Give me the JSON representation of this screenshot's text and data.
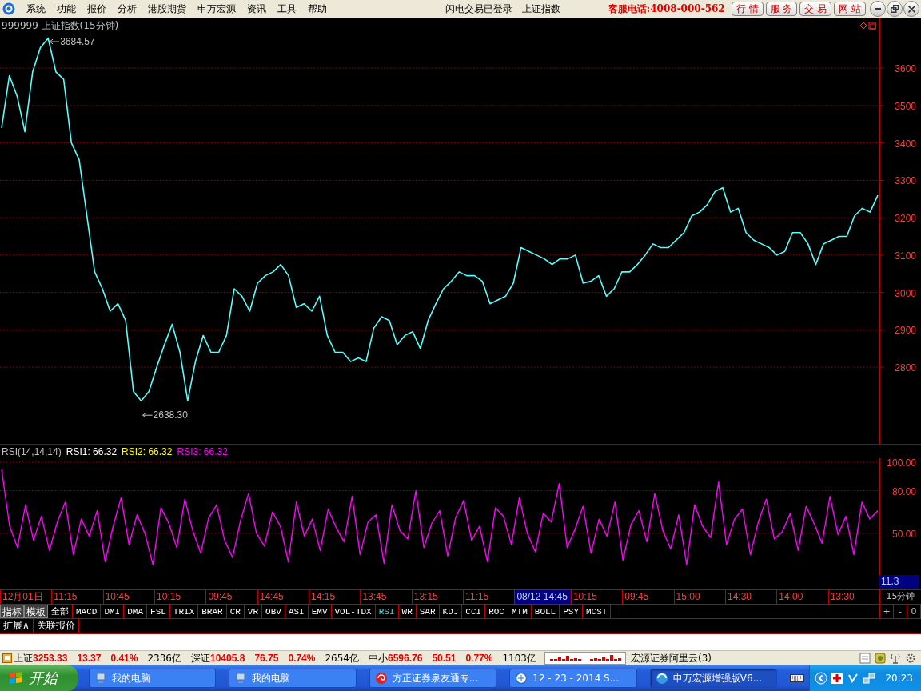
{
  "menu_bar": {
    "items": [
      "系统",
      "功能",
      "报价",
      "分析",
      "港股期货",
      "申万宏源",
      "资讯",
      "工具",
      "帮助"
    ],
    "status_texts": [
      "闪电交易已登录",
      "上证指数"
    ],
    "hotline": "客服电话:4008-000-562",
    "quick_buttons": [
      "行 情",
      "服 务",
      "交 易",
      "网 站"
    ]
  },
  "price_chart": {
    "title": "999999 上证指数(15分钟)",
    "chart_data": {
      "type": "line",
      "grid": true,
      "ylim": [
        2595,
        3735
      ],
      "yticks": [
        2800,
        2900,
        3000,
        3100,
        3200,
        3300,
        3400,
        3500,
        3600
      ],
      "series": [
        {
          "color": "#54ffff",
          "values": [
            3440,
            3580,
            3525,
            3430,
            3590,
            3655,
            3680,
            3590,
            3570,
            3400,
            3355,
            3205,
            3055,
            3010,
            2950,
            2970,
            2925,
            2735,
            2710,
            2735,
            2800,
            2860,
            2915,
            2840,
            2710,
            2815,
            2885,
            2840,
            2840,
            2885,
            3010,
            2990,
            2950,
            3025,
            3045,
            3055,
            3075,
            3045,
            2960,
            2970,
            2950,
            2990,
            2885,
            2840,
            2840,
            2815,
            2825,
            2815,
            2905,
            2935,
            2925,
            2860,
            2885,
            2895,
            2850,
            2925,
            2970,
            3010,
            3030,
            3055,
            3045,
            3045,
            3030,
            2970,
            2980,
            2990,
            3025,
            3120,
            3110,
            3100,
            3090,
            3075,
            3090,
            3090,
            3100,
            3025,
            3030,
            3045,
            2990,
            3010,
            3055,
            3055,
            3075,
            3100,
            3130,
            3120,
            3120,
            3140,
            3160,
            3205,
            3215,
            3235,
            3270,
            3280,
            3215,
            3225,
            3160,
            3140,
            3130,
            3120,
            3100,
            3110,
            3160,
            3160,
            3130,
            3075,
            3130,
            3140,
            3150,
            3150,
            3205,
            3225,
            3215,
            3260
          ]
        }
      ]
    },
    "high_label": "3684.57",
    "low_label": "2638.30"
  },
  "rsi_panel": {
    "legend": [
      {
        "text": "RSI(14,14,14)",
        "color": "#c0c0c0"
      },
      {
        "text": "RSI1: 66.32",
        "color": "#ffffff"
      },
      {
        "text": "RSI2: 66.32",
        "color": "#ffff00"
      },
      {
        "text": "RSI3: 66.32",
        "color": "#ff00ff"
      }
    ],
    "chart_data": {
      "type": "line",
      "grid": true,
      "ylim": [
        10.6,
        102.8
      ],
      "yticks": [
        {
          "value": 50,
          "label": "50.00"
        },
        {
          "value": 80,
          "label": "80.00"
        },
        {
          "value": 100,
          "label": "100.00"
        }
      ],
      "series": [
        {
          "color": "#ff00ff",
          "values": [
            95,
            55,
            40,
            70,
            45,
            62,
            38,
            58,
            72,
            35,
            60,
            48,
            66,
            30,
            55,
            75,
            42,
            63,
            50,
            28,
            68,
            57,
            40,
            74,
            52,
            36,
            61,
            70,
            45,
            33,
            59,
            78,
            50,
            41,
            65,
            55,
            30,
            72,
            48,
            60,
            38,
            67,
            54,
            44,
            76,
            35,
            58,
            63,
            29,
            70,
            52,
            46,
            80,
            40,
            57,
            66,
            34,
            61,
            73,
            45,
            55,
            30,
            68,
            62,
            42,
            75,
            50,
            37,
            64,
            58,
            85,
            40,
            53,
            69,
            36,
            60,
            48,
            72,
            31,
            56,
            66,
            44,
            78,
            52,
            39,
            63,
            28,
            70,
            55,
            47,
            86,
            42,
            60,
            67,
            35,
            58,
            74,
            46,
            51,
            64,
            38,
            69,
            57,
            43,
            76,
            49,
            62,
            35,
            72,
            60,
            66
          ]
        }
      ]
    },
    "cursor_value": "11.3"
  },
  "time_axis": [
    {
      "label": "12月01日",
      "selected": false
    },
    {
      "label": "11:15",
      "selected": false
    },
    {
      "label": "10:45",
      "selected": false
    },
    {
      "label": "10:15",
      "selected": false
    },
    {
      "label": "09:45",
      "selected": false
    },
    {
      "label": "14:45",
      "selected": false
    },
    {
      "label": "14:15",
      "selected": false
    },
    {
      "label": "13:45",
      "selected": false
    },
    {
      "label": "13:15",
      "selected": false
    },
    {
      "label": "11:15",
      "selected": false
    },
    {
      "label": "08/12 14:45",
      "selected": true
    },
    {
      "label": "10:15",
      "selected": false
    },
    {
      "label": "09:45",
      "selected": false
    },
    {
      "label": "15:00",
      "selected": false
    },
    {
      "label": "14:30",
      "selected": false
    },
    {
      "label": "14:00",
      "selected": false
    },
    {
      "label": "13:30",
      "selected": false
    }
  ],
  "period": "15分钟",
  "panel_buttons": [
    "指标",
    "模板"
  ],
  "indicator_tabs": [
    {
      "label": "全部",
      "selected": false
    },
    {
      "label": "MACD",
      "selected": false
    },
    {
      "label": "DMI",
      "selected": false
    },
    {
      "label": "DMA",
      "selected": false
    },
    {
      "label": "FSL",
      "selected": false
    },
    {
      "label": "TRIX",
      "selected": false
    },
    {
      "label": "BRAR",
      "selected": false
    },
    {
      "label": "CR",
      "selected": false
    },
    {
      "label": "VR",
      "selected": false
    },
    {
      "label": "OBV",
      "selected": false
    },
    {
      "label": "ASI",
      "selected": false
    },
    {
      "label": "EMV",
      "selected": false
    },
    {
      "label": "VOL-TDX",
      "selected": false
    },
    {
      "label": "RSI",
      "selected": true
    },
    {
      "label": "WR",
      "selected": false
    },
    {
      "label": "SAR",
      "selected": false
    },
    {
      "label": "KDJ",
      "selected": false
    },
    {
      "label": "CCI",
      "selected": false
    },
    {
      "label": "ROC",
      "selected": false
    },
    {
      "label": "MTM",
      "selected": false
    },
    {
      "label": "BOLL",
      "selected": false
    },
    {
      "label": "PSY",
      "selected": false
    },
    {
      "label": "MCST",
      "selected": false
    }
  ],
  "zoom_buttons": [
    "+",
    "-",
    "0"
  ],
  "extra_tabs": [
    "扩展∧",
    "关联报价"
  ],
  "status_bar": {
    "quotes": [
      {
        "name": "上证",
        "price": "3253.33",
        "change": "13.37",
        "percent": "0.41%",
        "turnover": "2336亿",
        "up": true
      },
      {
        "name": "深证",
        "price": "10405.8",
        "change": "76.75",
        "percent": "0.74%",
        "turnover": "2654亿",
        "up": true
      },
      {
        "name": "中小",
        "price": "6596.76",
        "change": "50.51",
        "percent": "0.77%",
        "turnover": "1103亿",
        "up": true
      }
    ],
    "server": "宏源证券阿里云(3)"
  },
  "taskbar": {
    "start": "开始",
    "tasks": [
      {
        "label": "我的电脑",
        "kind": "computer",
        "active": false
      },
      {
        "label": "我的电脑",
        "kind": "computer",
        "active": false
      },
      {
        "label": "方正证券泉友通专...",
        "kind": "swirl",
        "active": false
      },
      {
        "label": "12 - 23 - 2014 S...",
        "kind": "globe",
        "active": false
      },
      {
        "label": "申万宏源增强版V6...",
        "kind": "app",
        "active": true
      }
    ],
    "clock": "20:23"
  }
}
